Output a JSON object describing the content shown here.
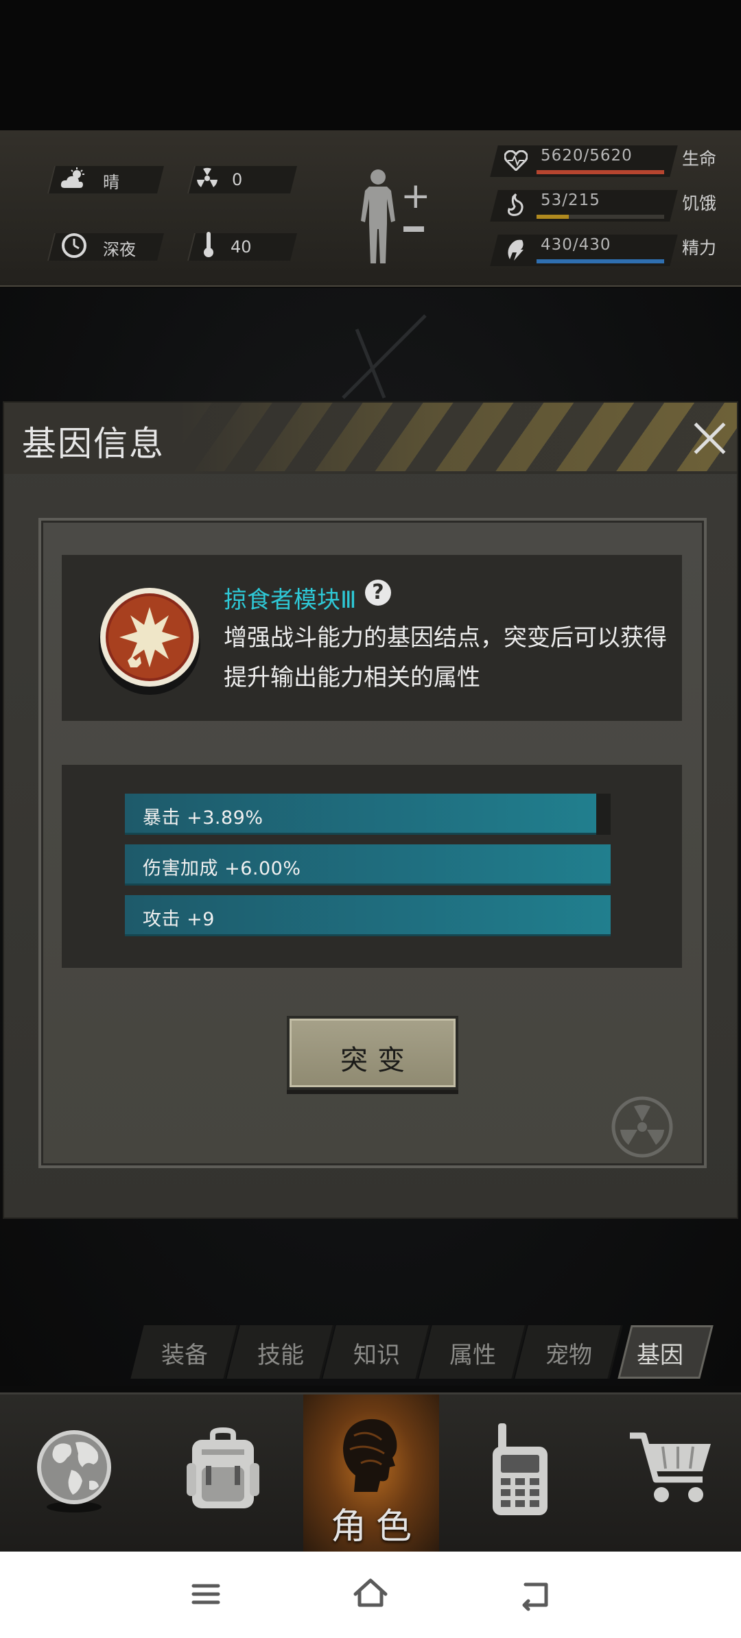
{
  "environment": {
    "weather_label": "晴",
    "time_label": "深夜",
    "radiation_value": "0",
    "temperature_value": "40"
  },
  "stats": [
    {
      "label": "生命",
      "value": "5620/5620",
      "fill": 1.0,
      "color": "#b6452f",
      "icon": "heart-icon"
    },
    {
      "label": "饥饿",
      "value": "53/215",
      "fill": 0.25,
      "color": "#b08a1f",
      "icon": "stomach-icon"
    },
    {
      "label": "精力",
      "value": "430/430",
      "fill": 1.0,
      "color": "#2f6fb0",
      "icon": "energy-icon"
    }
  ],
  "modal": {
    "title": "基因信息",
    "gene_name": "掠食者模块Ⅲ",
    "gene_description": "增强战斗能力的基因结点，突变后可以获得提升输出能力相关的属性",
    "attributes": [
      {
        "text": "暴击 +3.89%",
        "fill": 0.97
      },
      {
        "text": "伤害加成 +6.00%",
        "fill": 1.0
      },
      {
        "text": "攻击 +9",
        "fill": 1.0
      }
    ],
    "mutate_label": "突变"
  },
  "tabs": [
    "装备",
    "技能",
    "知识",
    "属性",
    "宠物",
    "基因"
  ],
  "active_tab": "基因",
  "bottom_nav": {
    "active_label": "角色"
  },
  "accent_colors": {
    "gene_name": "#2ec8d6",
    "bar": "#1f6f80",
    "active_nav": "#b56a20"
  }
}
